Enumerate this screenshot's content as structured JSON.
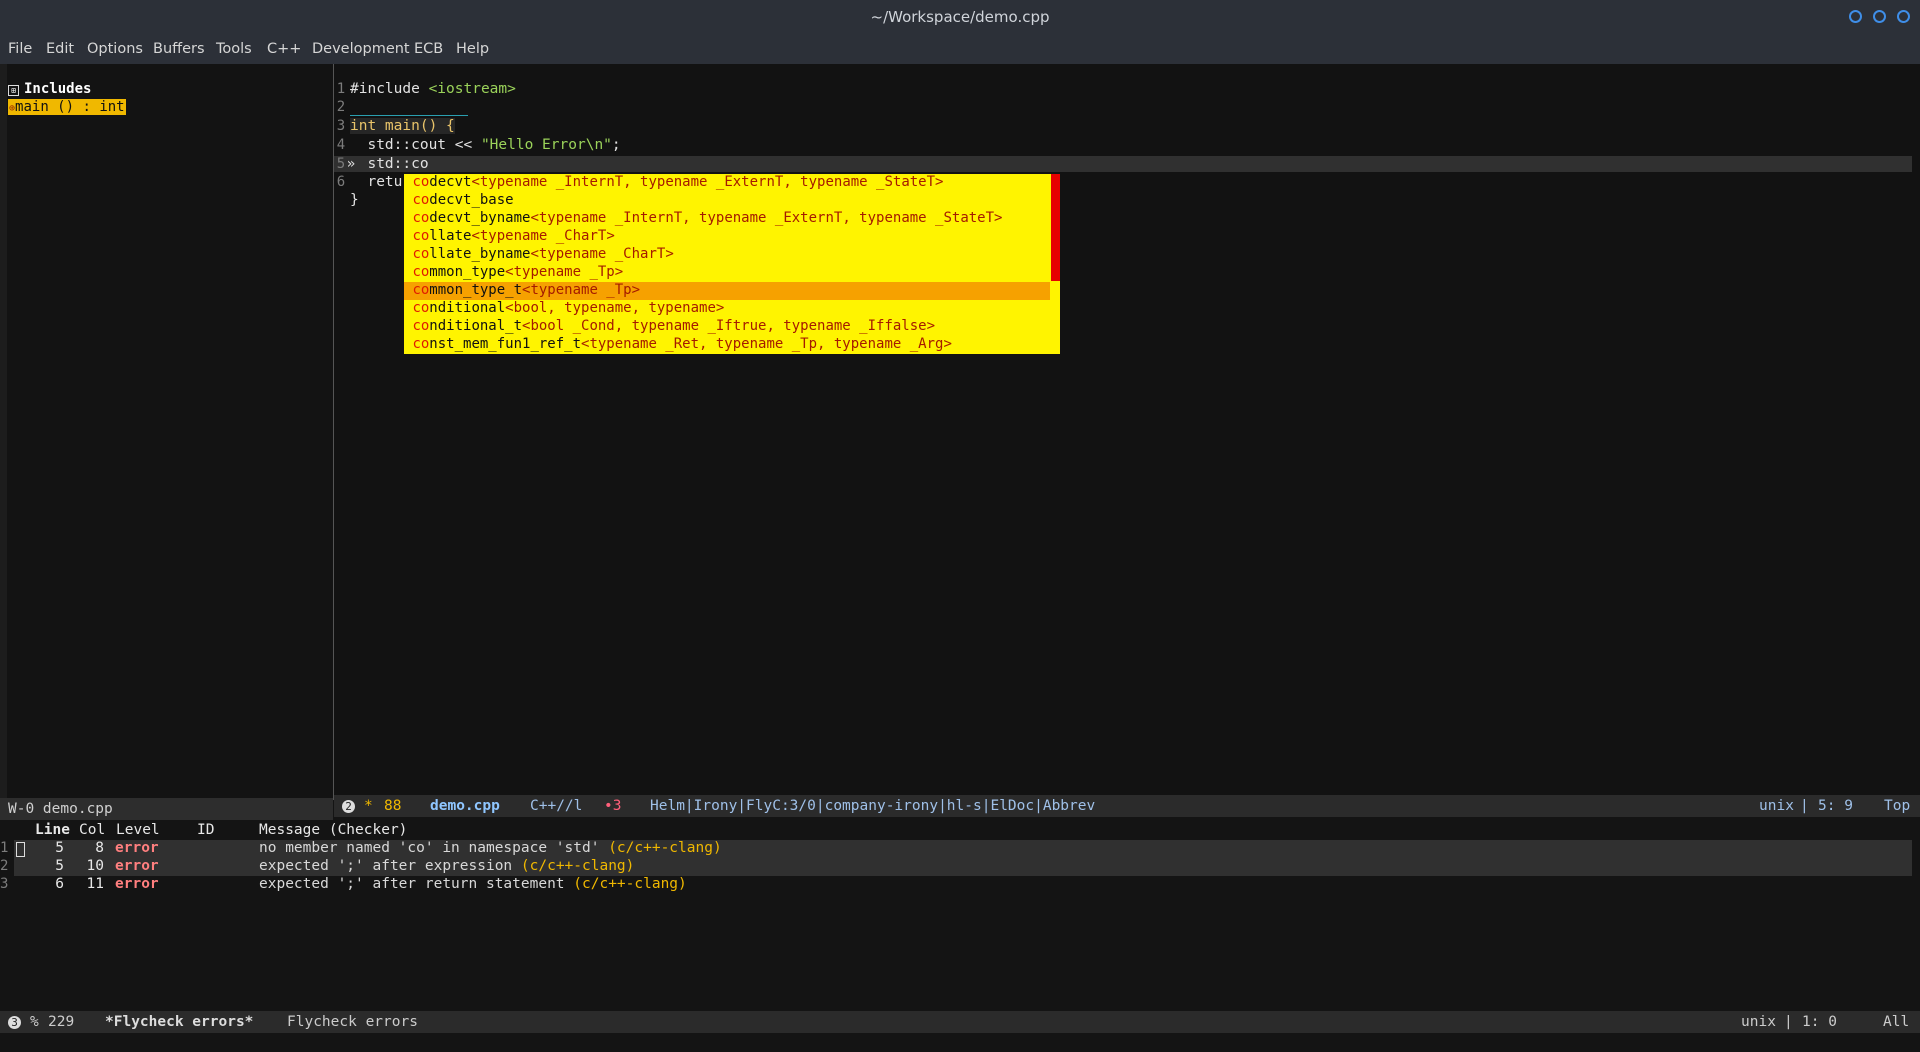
{
  "window": {
    "title": "~/Workspace/demo.cpp",
    "controls": [
      "minimize-icon",
      "maximize-icon",
      "close-icon"
    ],
    "accent": "#3f8ee8"
  },
  "menu": [
    "File",
    "Edit",
    "Options",
    "Buffers",
    "Tools",
    "C++",
    "Development",
    "ECB",
    "Help"
  ],
  "sidebar": {
    "tree_root": "Includes",
    "tree_root_toggle": "⊞",
    "selected_item": "main () : int",
    "selected_icon": "⊕",
    "modeline": "W-0 demo.cpp"
  },
  "editor": {
    "line_numbers": [
      "1",
      "2",
      "3",
      "4",
      "5",
      "6"
    ],
    "current_line_marker": "»",
    "lines": {
      "l1_directive": "#include ",
      "l1_header": "<iostream>",
      "l2": "",
      "l3_type": "int",
      "l3_rest": " main() {",
      "l4_pre": "  std::cout << ",
      "l4_str": "\"Hello Error\\n\"",
      "l4_post": ";",
      "l5": "  std::co",
      "l6": "  retu",
      "l7": "}"
    },
    "completion": {
      "prefix": "co",
      "selected_index": 6,
      "items": [
        {
          "match": "co",
          "name": "decvt",
          "sig": "<typename _InternT, typename _ExternT, typename _StateT>"
        },
        {
          "match": "co",
          "name": "decvt_base",
          "sig": ""
        },
        {
          "match": "co",
          "name": "decvt_byname",
          "sig": "<typename _InternT, typename _ExternT, typename _StateT>"
        },
        {
          "match": "co",
          "name": "llate",
          "sig": "<typename _CharT>"
        },
        {
          "match": "co",
          "name": "llate_byname",
          "sig": "<typename _CharT>"
        },
        {
          "match": "co",
          "name": "mmon_type",
          "sig": "<typename _Tp>"
        },
        {
          "match": "co",
          "name": "mmon_type_t",
          "sig": "<typename _Tp>"
        },
        {
          "match": "co",
          "name": "nditional",
          "sig": "<bool, typename, typename>"
        },
        {
          "match": "co",
          "name": "nditional_t",
          "sig": "<bool _Cond, typename _Iftrue, typename _Iffalse>"
        },
        {
          "match": "co",
          "name": "nst_mem_fun1_ref_t",
          "sig": "<typename _Ret, typename _Tp, typename _Arg>"
        }
      ],
      "colors": {
        "background": "#fff400",
        "selected": "#f6a100",
        "scrollbar": "#e60000"
      }
    }
  },
  "main_modeline": {
    "window_num": "2",
    "modified": "*",
    "size": "88",
    "buffer": "demo.cpp",
    "mode": "C++//l",
    "errors": "•3",
    "minor_modes": "Helm|Irony|FlyC:3/0|company-irony|hl-s|ElDoc|Abbrev",
    "encoding": "unix",
    "position": "5: 9",
    "scroll": "Top"
  },
  "errors_list": {
    "headers": {
      "line": "Line",
      "col": "Col",
      "level": "Level",
      "id": "ID",
      "message": "Message (Checker)"
    },
    "rows": [
      {
        "num": "1",
        "line": "5",
        "col": "8",
        "level": "error",
        "message": "no member named 'co' in namespace 'std' ",
        "checker": "(c/c++-clang)"
      },
      {
        "num": "2",
        "line": "5",
        "col": "10",
        "level": "error",
        "message": "expected ';' after expression ",
        "checker": "(c/c++-clang)"
      },
      {
        "num": "3",
        "line": "6",
        "col": "11",
        "level": "error",
        "message": "expected ';' after return statement ",
        "checker": "(c/c++-clang)"
      }
    ]
  },
  "errors_modeline": {
    "window_num": "3",
    "percent": "%",
    "size": "229",
    "buffer": "*Flycheck errors*",
    "mode": "Flycheck errors",
    "encoding": "unix",
    "position": "1: 0",
    "scroll": "All"
  }
}
